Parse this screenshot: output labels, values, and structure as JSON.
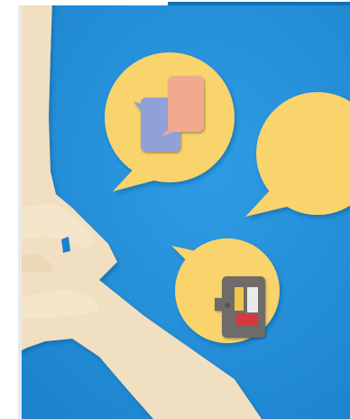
{
  "image": {
    "subject": "",
    "colors": {
      "background": "#1f8fdc",
      "bubble": "#f9d36a",
      "paper": "#f1dfc0",
      "chat_blue": "#8f9fd6",
      "chat_peach": "#f0a98c",
      "device_gray": "#6d6966",
      "device_yellow": "#f0c54f",
      "device_red": "#d6353b"
    },
    "icons": [
      "speech-bubble-icon",
      "chat-icon",
      "video-camera-icon"
    ]
  }
}
